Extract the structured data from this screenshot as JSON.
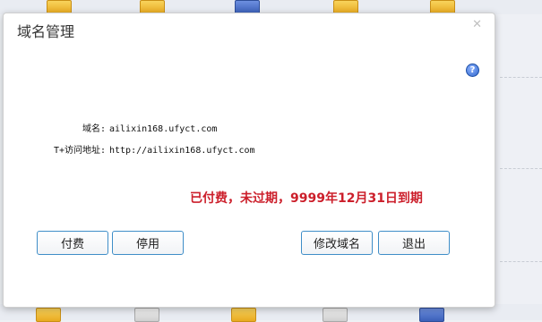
{
  "dialog": {
    "title": "域名管理",
    "close_icon": "close-icon",
    "help_icon": "help-icon",
    "help_glyph": "?"
  },
  "fields": {
    "domain_label": "域名:",
    "domain_value": "ailixin168.ufyct.com",
    "url_label": "T+访问地址:",
    "url_value": "http://ailixin168.ufyct.com"
  },
  "status": {
    "text": "已付费，未过期，9999年12月31日到期",
    "color": "#cc1f2b"
  },
  "buttons": {
    "pay": "付费",
    "disable": "停用",
    "modify_domain": "修改域名",
    "exit": "退出"
  }
}
